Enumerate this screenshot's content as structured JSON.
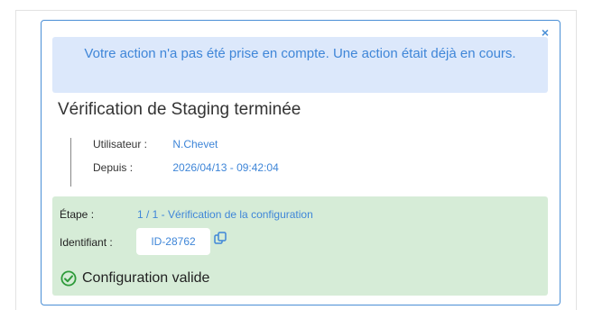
{
  "alert": {
    "message": "Votre action n'a pas été prise en compte. Une action était déjà en cours.",
    "close_glyph": "×"
  },
  "title": "Vérification de Staging terminée",
  "info": {
    "user_label": "Utilisateur :",
    "user_value": "N.Chevet",
    "since_label": "Depuis :",
    "since_value": "2026/04/13 - 09:42:04"
  },
  "details": {
    "step_label": "Étape :",
    "step_value": "1 / 1 - Vérification de la configuration",
    "id_label": "Identifiant :",
    "id_value": "ID-28762",
    "copy_icon": "copy-icon",
    "status_icon": "check-circle-icon",
    "status_text": "Configuration valide"
  },
  "colors": {
    "accent": "#3f86d8",
    "alert_bg": "#dce8fb",
    "success_bg": "#d6ecd7",
    "success_icon": "#2e9b3a"
  }
}
